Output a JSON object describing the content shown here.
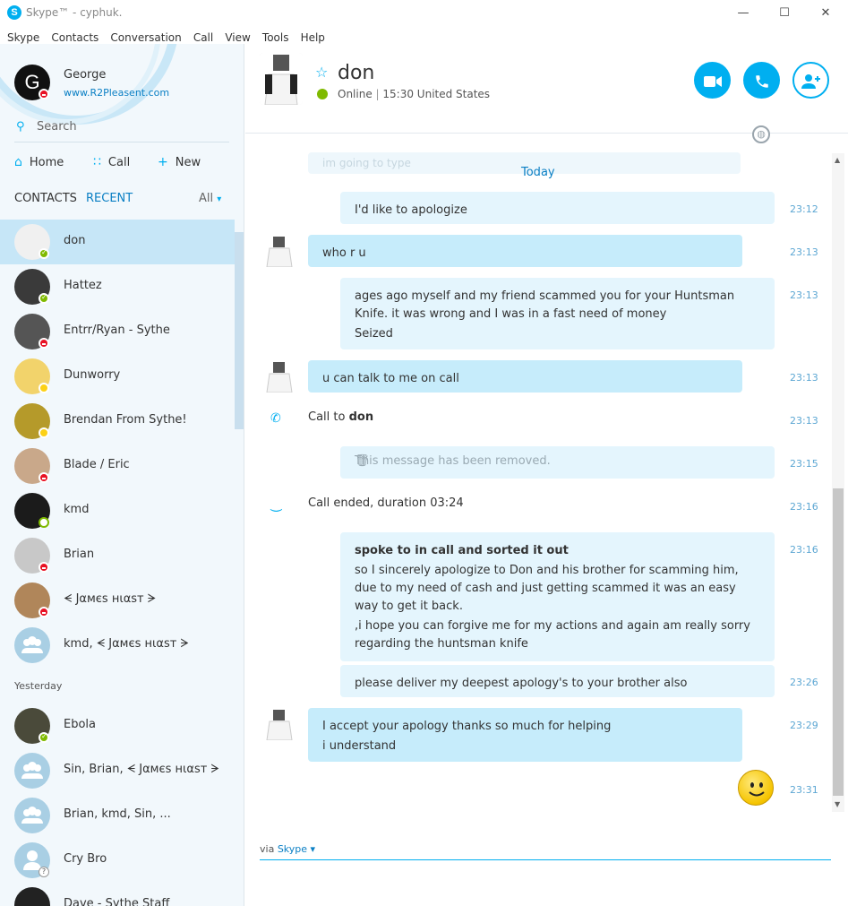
{
  "window": {
    "title": "Skype™ - cyphuk.",
    "minimize": "—",
    "maximize": "☐",
    "close": "✕"
  },
  "menu": [
    "Skype",
    "Contacts",
    "Conversation",
    "Call",
    "View",
    "Tools",
    "Help"
  ],
  "me": {
    "initial": "G",
    "name": "George",
    "mood": "www.R2Pleasent.com",
    "status": "dnd"
  },
  "search": {
    "placeholder": "Search"
  },
  "nav": {
    "home": "Home",
    "call": "Call",
    "new": "New"
  },
  "tabs": {
    "contacts": "CONTACTS",
    "recent": "RECENT",
    "filter": "All"
  },
  "recent": [
    {
      "name": "don",
      "status": "online",
      "avatar_color": "#f0f0f0"
    },
    {
      "name": "Hattez",
      "status": "online",
      "avatar_color": "#3a3a3a"
    },
    {
      "name": "Entrr/Ryan - Sythe",
      "status": "dnd",
      "avatar_color": "#555"
    },
    {
      "name": "Dunworry",
      "status": "away",
      "avatar_color": "#f2d36b"
    },
    {
      "name": "Brendan From Sythe!",
      "status": "away",
      "avatar_color": "#b59a2a"
    },
    {
      "name": "Blade / Eric",
      "status": "dnd",
      "avatar_color": "#c9a88a"
    },
    {
      "name": "kmd",
      "status": "offline",
      "avatar_color": "#1b1b1b"
    },
    {
      "name": "Brian",
      "status": "dnd",
      "avatar_color": "#c8c8c8"
    },
    {
      "name": "ᗕ Jαмєѕ нιαѕт ᗒ",
      "status": "dnd",
      "avatar_color": "#b0865a"
    },
    {
      "name": "kmd, ᗕ Jαмєѕ нιαѕт ᗒ",
      "status": "group",
      "avatar_color": "#a9cfe4"
    }
  ],
  "yesterday_label": "Yesterday",
  "yesterday": [
    {
      "name": "Ebola",
      "status": "online",
      "avatar_color": "#4a4a3a"
    },
    {
      "name": "Sin, Brian, ᗕ Jαмєѕ нιαѕт ᗒ",
      "status": "group",
      "avatar_color": "#a9cfe4"
    },
    {
      "name": "Brian, kmd, Sin, ...",
      "status": "group",
      "avatar_color": "#a9cfe4"
    },
    {
      "name": "Cry Bro",
      "status": "unknown",
      "avatar_color": "#a9cfe4"
    },
    {
      "name": "Dave - Sythe Staff",
      "status": "none",
      "avatar_color": "#222"
    }
  ],
  "peer": {
    "name": "don",
    "status_text": "Online",
    "time_location": "15:30 United States"
  },
  "chat": {
    "today": "Today",
    "ghost_text": "im going to type",
    "messages": [
      {
        "kind": "me",
        "lines": [
          "I'd like to apologize"
        ],
        "time": "23:12"
      },
      {
        "kind": "peer",
        "lines": [
          "who r u"
        ],
        "time": "23:13"
      },
      {
        "kind": "me",
        "lines": [
          "ages ago myself and my friend scammed you for your Huntsman Knife. it was wrong and I was in a fast need of money",
          "Seized"
        ],
        "time": "23:13"
      },
      {
        "kind": "peer",
        "lines": [
          "u can talk to me on call"
        ],
        "time": "23:13"
      },
      {
        "kind": "call",
        "text": "Call to ",
        "bold": "don",
        "time": "23:13"
      },
      {
        "kind": "removed",
        "text": "This message has been removed.",
        "time": "23:15"
      },
      {
        "kind": "callend",
        "text": "Call ended, duration 03:24",
        "time": "23:16"
      },
      {
        "kind": "me",
        "title": "spoke to in call and sorted it out",
        "lines": [
          "so I sincerely apologize to Don and his brother for scamming him, due to my need of cash and just getting scammed it was an easy way to get it back.",
          ",i hope you can forgive me for my actions and again am really sorry regarding the huntsman knife"
        ],
        "time": "23:16"
      },
      {
        "kind": "me",
        "lines": [
          "please deliver my deepest apology's to your brother also"
        ],
        "time": "23:26"
      },
      {
        "kind": "peer",
        "lines": [
          "I accept your apology thanks so much for helping",
          "i understand"
        ],
        "time": "23:29"
      },
      {
        "kind": "emoticon",
        "time": "23:31"
      }
    ]
  },
  "input": {
    "via": "via ",
    "via_link": "Skype ▾"
  },
  "colors": {
    "accent": "#00aff0",
    "online": "#7fba00",
    "dnd": "#e81123",
    "away": "#fcd116",
    "bubble_peer": "#c6ecfb",
    "bubble_me": "#e4f5fd"
  }
}
